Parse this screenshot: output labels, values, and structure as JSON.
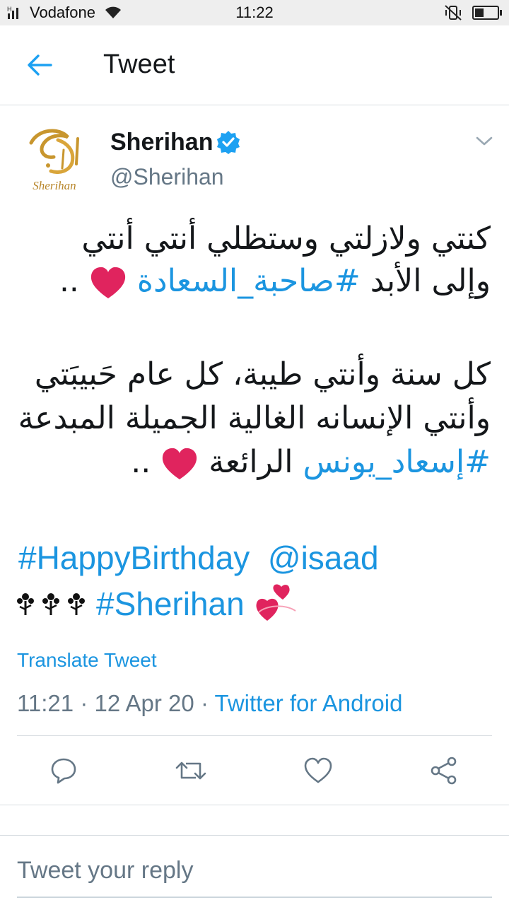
{
  "status_bar": {
    "carrier": "Vodafone",
    "network_indicator": "H",
    "time": "11:22",
    "battery_level": 0.35,
    "icons": [
      "signal-icon",
      "wifi-icon",
      "mute-vibrate-icon",
      "battery-icon"
    ]
  },
  "header": {
    "title": "Tweet",
    "back_icon": "arrow-left-icon"
  },
  "tweet": {
    "author": {
      "name": "Sherihan",
      "handle": "@Sherihan",
      "verified": true,
      "avatar_text": "Sherihan"
    },
    "lines": {
      "l1": "كنتي ولازلتي وستظلي أنتي أنتي",
      "l2_text": "وإلى الأبد",
      "l2_hashtag": "#صاحبة_السعادة",
      "l2_end": "..",
      "l3": "كل سنة وأنتي طيبة، كل عام حَبيبَتي",
      "l4": "وأنتي الإنسانه الغالية الجميلة المبدعة",
      "l5_hashtag": "#إسعاد_يونس",
      "l5_text": "الرائعة",
      "l5_end": "..",
      "en1_hashtag": "#HappyBirthday",
      "en1_mention": "@isaad",
      "en2_hashtag": "#Sherihan"
    },
    "emoji": [
      "red-heart",
      "red-heart",
      "flower-icon",
      "flower-icon",
      "flower-icon",
      "two-hearts"
    ],
    "translate_label": "Translate Tweet",
    "time": "11:21",
    "date": "12 Apr 20",
    "separator": "·",
    "source": "Twitter for Android"
  },
  "actions": [
    "reply-icon",
    "retweet-icon",
    "like-icon",
    "share-icon"
  ],
  "reply_placeholder": "Tweet your reply",
  "colors": {
    "link": "#1b95e0",
    "text": "#14171a",
    "secondary": "#657786",
    "heart": "#e0245e",
    "gold": "#c8962e"
  }
}
